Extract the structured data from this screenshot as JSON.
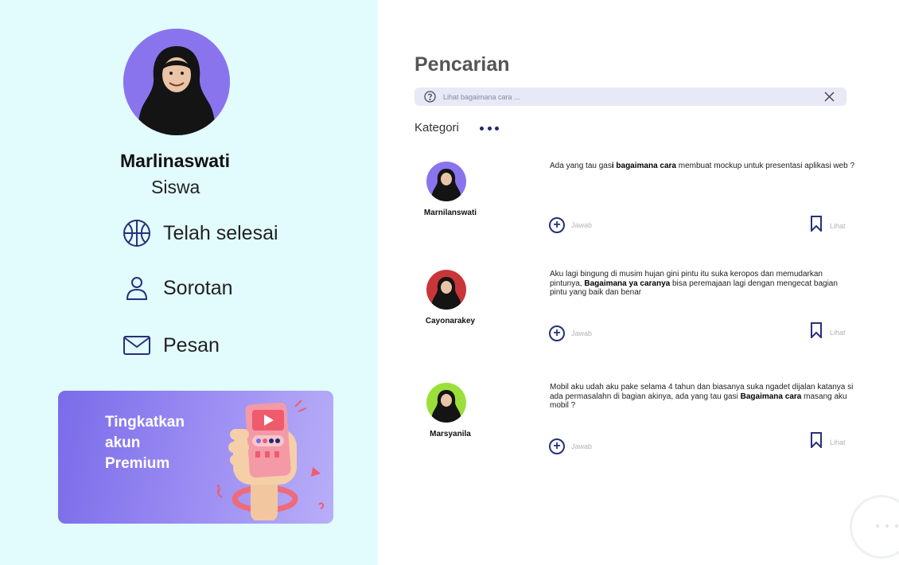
{
  "profile": {
    "name": "Marlinaswati",
    "role": "Siswa",
    "avatar_bg": "#8a74ee"
  },
  "nav": [
    {
      "label": "Telah selesai",
      "icon": "basketball-icon"
    },
    {
      "label": "Sorotan",
      "icon": "user-icon"
    },
    {
      "label": "Pesan",
      "icon": "mail-icon"
    }
  ],
  "promo": {
    "line1": "Tingkatkan",
    "line2": "akun",
    "line3": "Premium",
    "color_start": "#7a6be9",
    "color_end": "#b8aef8"
  },
  "main": {
    "title": "Pencarian",
    "search": {
      "placeholder": "Lihat bagaimana cara ..."
    },
    "category_label": "Kategori"
  },
  "posts": [
    {
      "user": "Marnilanswati",
      "avatar_bg": "#8a74ee",
      "text_parts": [
        "Ada yang tau gas",
        "i bagaimana cara",
        " membuat mockup untuk presentasi aplikasi web ?"
      ],
      "answer_label": "Jawab",
      "view_label": "Lihat"
    },
    {
      "user": "Cayonarakey",
      "avatar_bg": "#c9363a",
      "text_parts": [
        "Aku lagi bingung di musim hujan gini pintu itu suka keropos dan memudarkan pintunya, ",
        "Bagaimana ya caranya",
        " bisa peremajaan lagi dengan mengecat bagian pintu yang baik dan benar"
      ],
      "answer_label": "Jawab",
      "view_label": "Lihat"
    },
    {
      "user": "Marsyanila",
      "avatar_bg": "#9be03a",
      "text_parts": [
        "Mobil aku udah aku pake selama 4 tahun dan biasanya suka ngadet dijalan katanya si ada permasalahn di bagian akinya, ada yang tau gasi ",
        "Bagaimana cara",
        " masang aku mobil ?"
      ],
      "answer_label": "Jawab",
      "view_label": "Lihat"
    }
  ],
  "colors": {
    "left_bg": "#e2fbfd",
    "accent_navy": "#27307a",
    "search_bg": "#e7e9f6"
  }
}
